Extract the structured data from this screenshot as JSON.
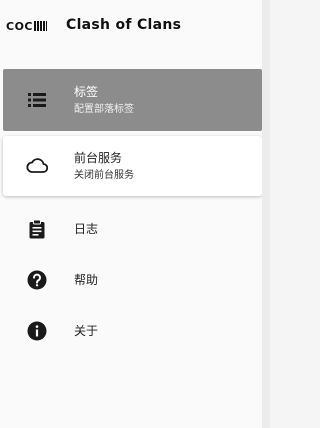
{
  "header": {
    "logo_text": "COC",
    "app_title": "Clash of Clans"
  },
  "nav": {
    "items": [
      {
        "label": "标签",
        "sublabel": "配置部落标签",
        "icon": "list-icon",
        "state": "selected"
      },
      {
        "label": "前台服务",
        "sublabel": "关闭前台服务",
        "icon": "cloud-icon",
        "state": "card"
      },
      {
        "label": "日志",
        "icon": "clipboard-icon"
      },
      {
        "label": "帮助",
        "icon": "help-circle-icon"
      },
      {
        "label": "关于",
        "icon": "info-circle-icon"
      }
    ]
  },
  "colors": {
    "selected_bg": "#8c8c8c",
    "drawer_bg": "#fafafa",
    "icon": "#1a1a1a"
  }
}
